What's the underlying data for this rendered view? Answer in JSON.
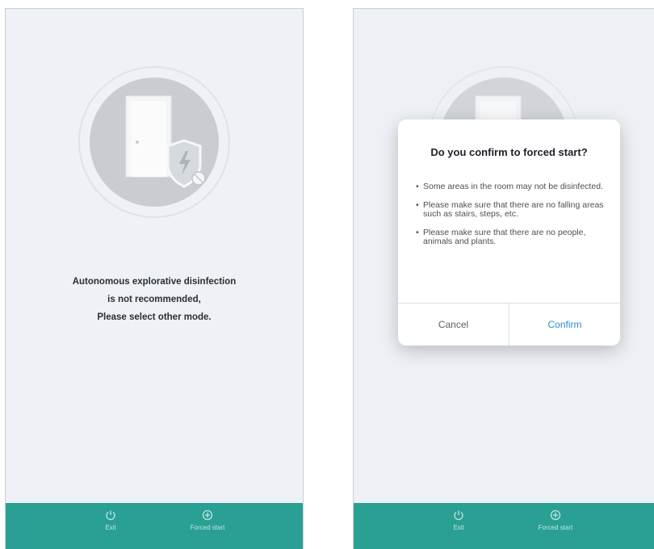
{
  "left_screen": {
    "message_lines": [
      "Autonomous explorative disinfection",
      "is not recommended,",
      "Please select other mode."
    ],
    "bottom_bar": {
      "exit_label": "Exit",
      "forced_start_label": "Forced start"
    }
  },
  "right_screen": {
    "dialog": {
      "title": "Do you confirm to forced start?",
      "items": [
        "Some areas in the room may not be disinfected.",
        "Please make sure that there are no falling areas such as stairs, steps, etc.",
        "Please make sure that there are no people, animals and plants."
      ],
      "cancel_label": "Cancel",
      "confirm_label": "Confirm"
    },
    "bottom_bar": {
      "exit_label": "Exit",
      "forced_start_label": "Forced start"
    }
  },
  "colors": {
    "accent_teal": "#2aa095",
    "confirm_blue": "#2f8fd0",
    "screen_bg": "#eef1f5"
  },
  "icons": [
    "door-shield-illustration",
    "power-icon",
    "plus-circle-icon"
  ]
}
